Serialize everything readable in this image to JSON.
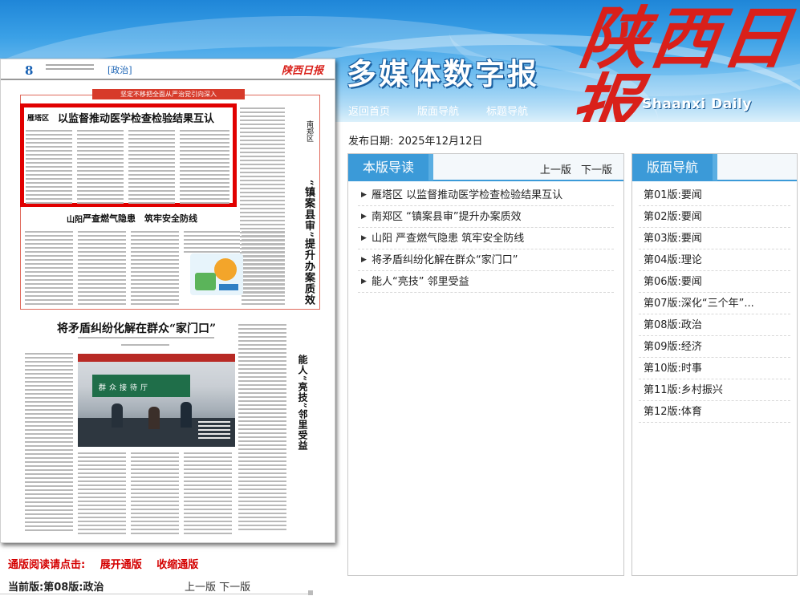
{
  "header": {
    "site_title": "多媒体数字报",
    "logo_cn": "陕西日报",
    "logo_en": "Shaanxi Daily",
    "nav": [
      "返回首页",
      "版面导航",
      "标题导航"
    ]
  },
  "publish": {
    "label": "发布日期:",
    "date": "2025年12月12日"
  },
  "paper_page": {
    "page_number": "8",
    "section": "[政治]",
    "mini_logo": "陕西日报",
    "slogan": "坚定不移把全面从严治党引向深入",
    "headline_label": "雁塔区",
    "headline": "以监督推动医学检查检验结果互认",
    "story2_label": "山阳",
    "story2_title": "严查燃气隐患　筑牢安全防线",
    "vertical_sub": "南郑区",
    "vertical_title": "“镇案县审”提升办案质效",
    "story3_title": "将矛盾纠纷化解在群众“家门口”",
    "story4_title": "能人“亮技”邻里受益",
    "photo_sign": "群众接待厅"
  },
  "reader_controls": {
    "prompt": "通版阅读请点击:",
    "expand": "展开通版",
    "collapse": "收缩通版",
    "current": "当前版:第08版:政治",
    "prev": "上一版",
    "next": "下一版"
  },
  "article_panel": {
    "title": "本版导读",
    "prev": "上一版",
    "next": "下一版",
    "arrow_icon": "triangle-right-icon",
    "items": [
      "雁塔区 以监督推动医学检查检验结果互认",
      "南郑区 “镇案县审”提升办案质效",
      "山阳 严查燃气隐患 筑牢安全防线",
      "将矛盾纠纷化解在群众“家门口”",
      "能人“亮技” 邻里受益"
    ]
  },
  "page_nav_panel": {
    "title": "版面导航",
    "items": [
      "第01版:要闻",
      "第02版:要闻",
      "第03版:要闻",
      "第04版:理论",
      "第06版:要闻",
      "第07版:深化“三个年”...",
      "第08版:政治",
      "第09版:经济",
      "第10版:时事",
      "第11版:乡村振兴",
      "第12版:体育"
    ]
  },
  "colors": {
    "accent_blue": "#3b9ad8",
    "brand_red": "#d9201a",
    "link_red": "#d40000",
    "highlight_red": "#e10000"
  }
}
